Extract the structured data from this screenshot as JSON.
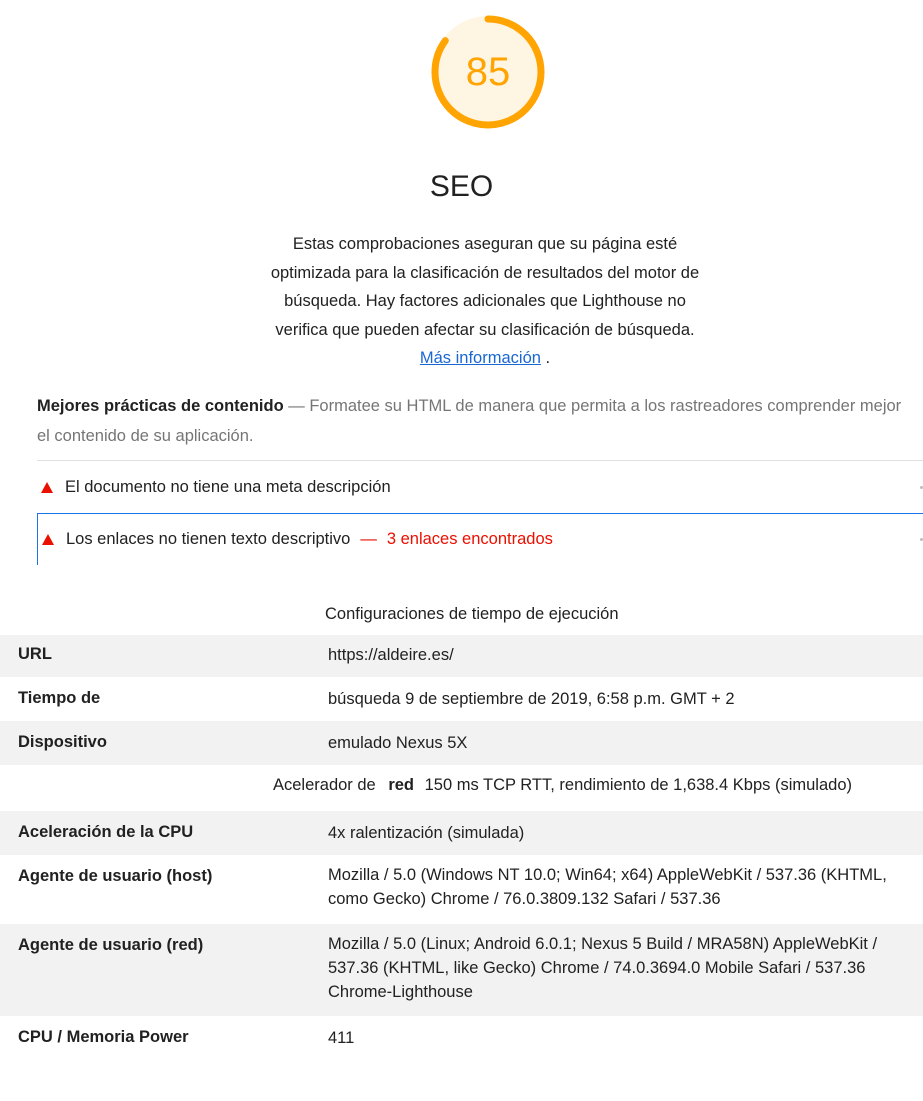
{
  "seo": {
    "score": "85",
    "score_fraction": 0.85,
    "gauge_color": "#ffa400",
    "title": "SEO",
    "description": "Estas comprobaciones aseguran que su página esté optimizada para la clasificación de resultados del motor de búsqueda. Hay factores adicionales que Lighthouse no verifica que pueden afectar su clasificación de búsqueda.",
    "learn_more": "Más información",
    "learn_more_suffix": "."
  },
  "group": {
    "title": "Mejores prácticas de contenido",
    "separator": "—",
    "description": "Formatee su HTML de manera que permita a los rastreadores comprender mejor el contenido de su aplicación."
  },
  "audits": [
    {
      "title": "El documento no tiene una meta descripción",
      "status_icon": "fail-triangle-icon"
    },
    {
      "title": "Los enlaces no tienen texto descriptivo",
      "separator": "—",
      "display_value": "3 enlaces encontrados",
      "status_icon": "fail-triangle-icon"
    }
  ],
  "runtime": {
    "title": "Configuraciones de tiempo de ejecución",
    "rows": {
      "url": {
        "label": "URL",
        "value": "https://aldeire.es/"
      },
      "fetch": {
        "label": "Tiempo de",
        "value": "búsqueda 9 de septiembre de 2019, 6:58 p.m. GMT + 2"
      },
      "device": {
        "label": "Dispositivo",
        "value": "emulado Nexus 5X"
      },
      "network": {
        "prefix": "Acelerador de",
        "bold": "red",
        "value": "150 ms TCP RTT, rendimiento de 1,638.4 Kbps (simulado)"
      },
      "cpu": {
        "label": "Aceleración de la CPU",
        "value": "4x ralentización (simulada)"
      },
      "ua_host": {
        "label": "Agente de usuario (host)",
        "value": "Mozilla / 5.0 (Windows NT 10.0; Win64; x64) AppleWebKit / 537.36 (KHTML, como Gecko) Chrome / 76.0.3809.132 Safari / 537.36"
      },
      "ua_net": {
        "label": "Agente de usuario (red)",
        "value": "Mozilla / 5.0 (Linux; Android 6.0.1; Nexus 5 Build / MRA58N) AppleWebKit / 537.36 (KHTML, like Gecko) Chrome / 74.0.3694.0 Mobile Safari / 537.36 Chrome-Lighthouse"
      },
      "benchmark": {
        "label": "CPU / Memoria Power",
        "value": "411"
      }
    }
  }
}
